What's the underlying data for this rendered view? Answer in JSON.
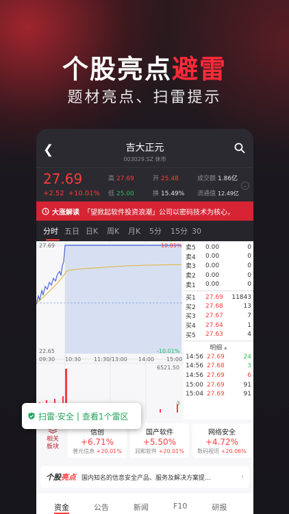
{
  "promo": {
    "headline_white": "个股亮点",
    "headline_red": "避雷",
    "subline": "题材亮点、扫雷提示"
  },
  "nav": {
    "title": "吉大正元",
    "subtitle": "003029.SZ 休市"
  },
  "quote": {
    "price": "27.69",
    "change": "+2.52",
    "change_pct": "+10.01%",
    "high_label": "高",
    "high": "27.69",
    "open_label": "开",
    "open": "25.48",
    "turnover_label": "成交额",
    "turnover": "1.86亿",
    "low_label": "低",
    "low": "25.00",
    "rate_label": "换",
    "rate": "15.49%",
    "float_label": "流通值",
    "float": "12.49亿"
  },
  "ticker": {
    "label": "大涨解读",
    "text": "「望掀起软件投资浪潮」公司以密码技术为核心，"
  },
  "tabs": [
    "分时",
    "五日",
    "日K",
    "周K",
    "月K",
    "5分",
    "15分",
    "30"
  ],
  "chart": {
    "top_price": "27.69",
    "top_pct": "10.01%",
    "bottom_price": "22.65",
    "bottom_pct": "-10.01%",
    "times": [
      "09:30",
      "10:30",
      "11:30/13:00",
      "14:00",
      "15:00"
    ],
    "volume_max": "6521.50",
    "volume_unit": "手"
  },
  "book": {
    "sells": [
      {
        "k": "卖5",
        "p": "0.00",
        "q": "0"
      },
      {
        "k": "卖4",
        "p": "0.00",
        "q": "0"
      },
      {
        "k": "卖3",
        "p": "0.00",
        "q": "0"
      },
      {
        "k": "卖2",
        "p": "0.00",
        "q": "0"
      },
      {
        "k": "卖1",
        "p": "0.00",
        "q": "0"
      }
    ],
    "buys": [
      {
        "k": "买1",
        "p": "27.69",
        "q": "11843"
      },
      {
        "k": "买2",
        "p": "27.68",
        "q": "13"
      },
      {
        "k": "买3",
        "p": "27.67",
        "q": "7"
      },
      {
        "k": "买4",
        "p": "27.64",
        "q": "1"
      },
      {
        "k": "买5",
        "p": "27.63",
        "q": "4"
      }
    ],
    "detail_label": "明细",
    "trades": [
      {
        "t": "14:56",
        "p": "27.69",
        "q": "24"
      },
      {
        "t": "14:56",
        "p": "27.68",
        "q": "3"
      },
      {
        "t": "14:56",
        "p": "27.69",
        "q": "6"
      },
      {
        "t": "15:00",
        "p": "27.69",
        "q": "91"
      },
      {
        "t": "15:04",
        "p": "27.69",
        "q": "91"
      }
    ]
  },
  "popup": {
    "scan": "扫雷·安全",
    "pipe": "|",
    "link": "查看1个雷区"
  },
  "sectors": {
    "side": "相关板块",
    "items": [
      {
        "name": "信创",
        "pct": "+6.71%",
        "stock": "普元信息",
        "stock_pct": "+20.01%"
      },
      {
        "name": "国产软件",
        "pct": "+5.50%",
        "stock": "润和软件",
        "stock_pct": "+20.01%"
      },
      {
        "name": "网络安全",
        "pct": "+4.72%",
        "stock": "数码视讯",
        "stock_pct": "+20.06%"
      }
    ]
  },
  "brief": {
    "logo_a": "个股",
    "logo_b": "亮点",
    "text": "国内知名的信息安全产品、服务及解决方案提...",
    "arrow": "›"
  },
  "bottom_tabs": [
    "资金",
    "公告",
    "新闻",
    "F10",
    "研报"
  ],
  "colors": {
    "up": "#ff3b3b",
    "down": "#2dbd5a",
    "ticker_bg": "#d62434",
    "safe_green": "#23a35a"
  }
}
